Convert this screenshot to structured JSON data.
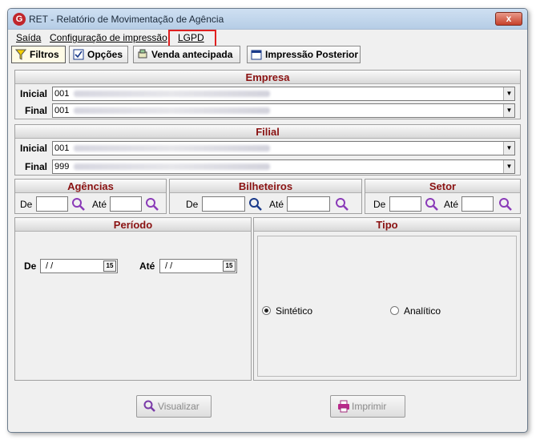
{
  "window": {
    "title": "RET - Relatório de Movimentação de Agência",
    "icon": "app-logo-icon",
    "close_label": "x"
  },
  "menu": {
    "items": [
      "Saída",
      "Configuração de impressão",
      "LGPD"
    ]
  },
  "toolbar": {
    "filtros": "Filtros",
    "opcoes": "Opções",
    "venda": "Venda antecipada",
    "impressao": "Impressão Posterior"
  },
  "empresa": {
    "title": "Empresa",
    "inicial_label": "Inicial",
    "inicial_code": "001",
    "final_label": "Final",
    "final_code": "001"
  },
  "filial": {
    "title": "Filial",
    "inicial_label": "Inicial",
    "inicial_code": "001",
    "final_label": "Final",
    "final_code": "999"
  },
  "agencias": {
    "title": "Agências",
    "de": "De",
    "ate": "Até"
  },
  "bilheteiros": {
    "title": "Bilheteiros",
    "de": "De",
    "ate": "Até"
  },
  "setor": {
    "title": "Setor",
    "de": "De",
    "ate": "Até"
  },
  "periodo": {
    "title": "Período",
    "de": "De",
    "de_value": "/ /",
    "ate": "Até",
    "ate_value": "/ /",
    "cal_label": "15"
  },
  "tipo": {
    "title": "Tipo",
    "sintetico": "Sintético",
    "analitico": "Analítico",
    "selected": "Sintético"
  },
  "buttons": {
    "visualizar": "Visualizar",
    "imprimir": "Imprimir"
  },
  "colors": {
    "section_title": "#8a1212",
    "highlight": "#e02020",
    "search": "#8a3ab8"
  }
}
